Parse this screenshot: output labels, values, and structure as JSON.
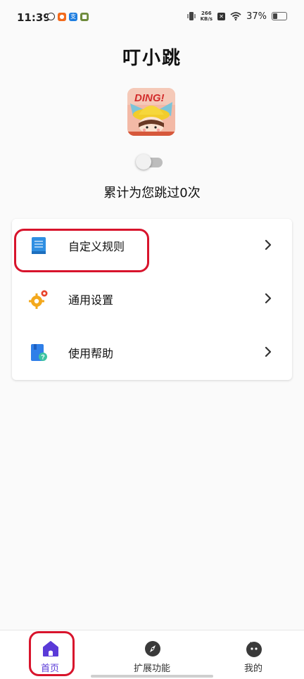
{
  "status_bar": {
    "time": "11:39",
    "notification_icons": [
      "sync-icon",
      "app-orange-icon",
      "alipay-icon",
      "game-icon"
    ],
    "net_speed_value": "266",
    "net_speed_unit": "KB/s",
    "battery_percent": "37%"
  },
  "app": {
    "title": "叮小跳",
    "logo_text": "DING!",
    "toggle_on": false,
    "skip_count_text": "累计为您跳过0次"
  },
  "menu": {
    "items": [
      {
        "label": "自定义规则",
        "icon": "document-icon"
      },
      {
        "label": "通用设置",
        "icon": "settings-gears-icon"
      },
      {
        "label": "使用帮助",
        "icon": "help-book-icon"
      }
    ]
  },
  "bottom_nav": {
    "items": [
      {
        "label": "首页",
        "icon": "home-icon",
        "active": true
      },
      {
        "label": "扩展功能",
        "icon": "compass-icon",
        "active": false
      },
      {
        "label": "我的",
        "icon": "profile-face-icon",
        "active": false
      }
    ]
  },
  "colors": {
    "accent": "#5a3ad8",
    "annotation": "#d8142c",
    "toggle_track": "#bdbdbd"
  }
}
